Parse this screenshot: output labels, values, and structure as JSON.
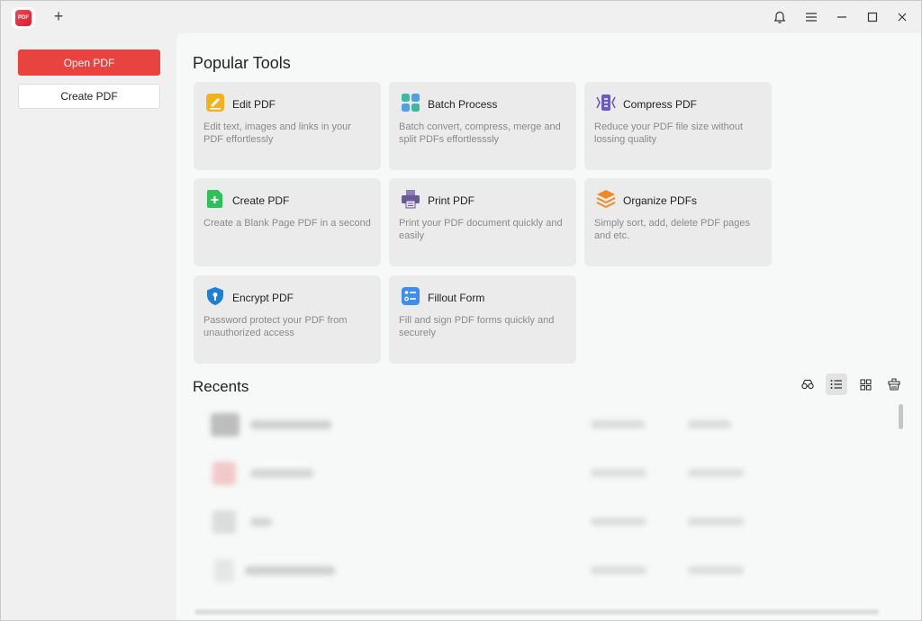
{
  "titlebar": {
    "logo_text": "PDF",
    "new_tab": "+"
  },
  "sidebar": {
    "open_pdf": "Open PDF",
    "create_pdf": "Create PDF"
  },
  "main": {
    "popular_tools_title": "Popular Tools",
    "tools": [
      {
        "name": "Edit PDF",
        "desc": "Edit text, images and links in your PDF effortlessly",
        "icon": "edit-icon",
        "color": "#f2b21b"
      },
      {
        "name": "Batch Process",
        "desc": "Batch convert, compress, merge and split PDFs effortlesssly",
        "icon": "batch-icon",
        "color": "#3cb8a3"
      },
      {
        "name": "Compress PDF",
        "desc": "Reduce your PDF file size without lossing quality",
        "icon": "compress-icon",
        "color": "#6a5acd"
      },
      {
        "name": "Create PDF",
        "desc": "Create a Blank Page PDF in a second",
        "icon": "create-icon",
        "color": "#2fbf5b"
      },
      {
        "name": "Print PDF",
        "desc": "Print your PDF document quickly and easily",
        "icon": "print-icon",
        "color": "#6b5b95"
      },
      {
        "name": "Organize PDFs",
        "desc": "Simply sort, add, delete PDF pages and etc.",
        "icon": "organize-icon",
        "color": "#f08a24"
      },
      {
        "name": "Encrypt PDF",
        "desc": "Password protect your PDF from unauthorized access",
        "icon": "shield-icon",
        "color": "#1e7fd8"
      },
      {
        "name": "Fillout Form",
        "desc": "Fill and sign PDF forms quickly and securely",
        "icon": "form-icon",
        "color": "#3d8ef0"
      }
    ],
    "recents_title": "Recents"
  },
  "colors": {
    "accent": "#e8433e",
    "background": "#f0f0f0",
    "panel": "#f7f8f8",
    "card": "#ebebeb"
  }
}
